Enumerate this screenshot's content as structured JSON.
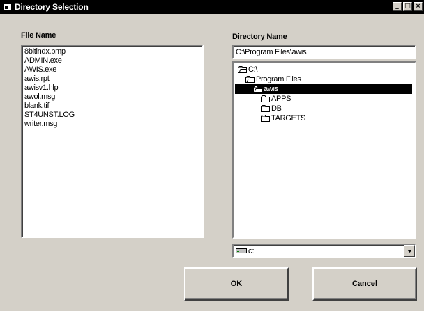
{
  "window": {
    "title": "Directory Selection",
    "controls": {
      "minimize": "_",
      "maximize": "□",
      "close": "×"
    }
  },
  "file_panel": {
    "label": "File Name",
    "files": [
      "8bitindx.bmp",
      "ADMIN.exe",
      "AWIS.exe",
      "awis.rpt",
      "awisv1.hlp",
      "awol.msg",
      "blank.tif",
      "ST4UNST.LOG",
      "writer.msg"
    ]
  },
  "directory_panel": {
    "label": "Directory Name",
    "path": "C:\\Program Files\\awis",
    "tree": [
      {
        "label": "C:\\",
        "depth": 0,
        "icon": "open-folder-icon",
        "selected": false
      },
      {
        "label": "Program Files",
        "depth": 1,
        "icon": "open-folder-icon",
        "selected": false
      },
      {
        "label": "awis",
        "depth": 2,
        "icon": "open-folder-icon",
        "selected": true
      },
      {
        "label": "APPS",
        "depth": 3,
        "icon": "closed-folder-icon",
        "selected": false
      },
      {
        "label": "DB",
        "depth": 3,
        "icon": "closed-folder-icon",
        "selected": false
      },
      {
        "label": "TARGETS",
        "depth": 3,
        "icon": "closed-folder-icon",
        "selected": false
      }
    ]
  },
  "drive": {
    "selected": "c:",
    "icon": "drive-icon"
  },
  "buttons": {
    "ok": "OK",
    "cancel": "Cancel"
  },
  "colors": {
    "face": "#d4d0c8",
    "titlebar": "#000000",
    "selection": "#000000"
  }
}
